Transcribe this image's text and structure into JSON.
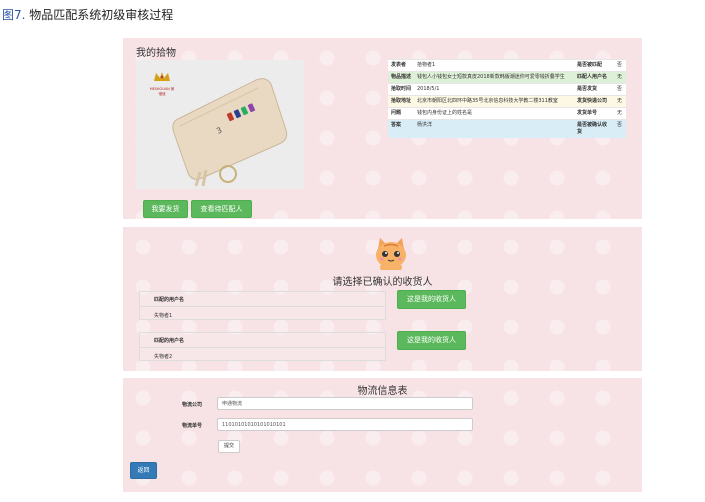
{
  "caption": {
    "fig": "图7.",
    "text": " 物品匹配系统初级审核过程"
  },
  "found_panel": {
    "title": "我的拾物",
    "logo_text": "MEIXIGUAN 美惜冠",
    "buttons": {
      "ship": "我要发货",
      "view_matches": "查看待匹配人"
    },
    "rows": [
      {
        "k1": "发表者",
        "v1": "拾物者1",
        "k2": "是否被匹配",
        "v2": "否"
      },
      {
        "k1": "物品描述",
        "v1": "钱包人小钱包女士短款真皮2018新款韩版潮迷你可爱零钱折叠学生",
        "k2": "匹配人用户名",
        "v2": "无"
      },
      {
        "k1": "拾取时间",
        "v1": "2018/5/1",
        "k2": "是否发货",
        "v2": "否"
      },
      {
        "k1": "拾取地址",
        "v1": "北京市朝阳区北四环中路35号北京信息科技大学教二楼311教室",
        "k2": "发货快递公司",
        "v2": "无"
      },
      {
        "k1": "问题",
        "v1": "钱包内身份证上的姓名是",
        "k2": "发货单号",
        "v2": "无"
      },
      {
        "k1": "答案",
        "v1": "杨洪洋",
        "k2": "是否被确认收货",
        "v2": "否"
      }
    ]
  },
  "select_panel": {
    "heading": "请选择已确认的收货人",
    "matches": [
      {
        "label": "匹配的用户名",
        "value": "失物者1",
        "button": "这是我的收货人"
      },
      {
        "label": "匹配的用户名",
        "value": "失物者2",
        "button": "这是我的收货人"
      }
    ]
  },
  "logistics": {
    "title": "物流信息表",
    "company_label": "物流公司",
    "company_value": "申通物流",
    "number_label": "物流单号",
    "number_value": "11010101010101010101",
    "submit": "提交",
    "back": "返回"
  },
  "colors": {
    "panel_bg": "#f7e3e6",
    "success": "#5cb85c",
    "primary": "#337ab7",
    "row_green": "#dff0d8",
    "row_yellow": "#fcf8e3",
    "row_blue": "#d9edf7"
  }
}
